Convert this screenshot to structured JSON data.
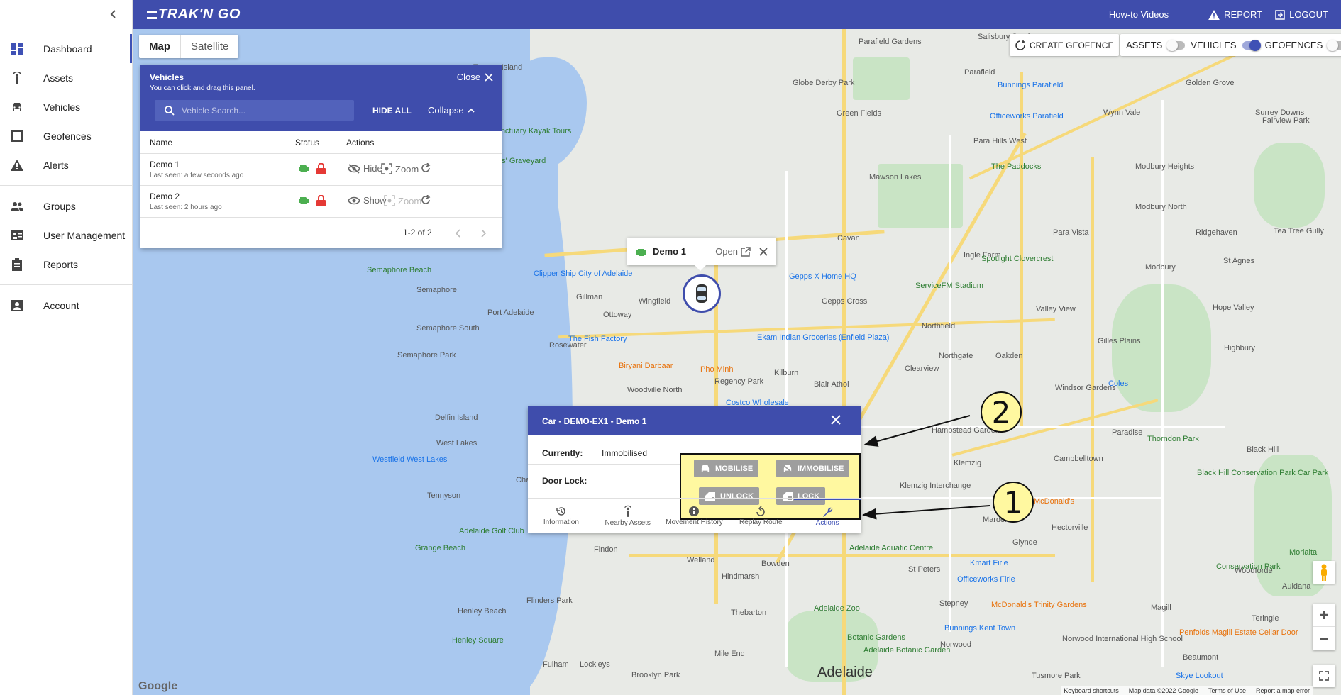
{
  "app": {
    "logo": "TRAK'N GO"
  },
  "sidebar": {
    "items": [
      {
        "label": "Dashboard",
        "icon": "dashboard-icon",
        "active": true
      },
      {
        "label": "Assets",
        "icon": "tracker-icon"
      },
      {
        "label": "Vehicles",
        "icon": "car-icon"
      },
      {
        "label": "Geofences",
        "icon": "square-icon"
      },
      {
        "label": "Alerts",
        "icon": "warning-icon"
      },
      {
        "label": "Groups",
        "icon": "groups-icon"
      },
      {
        "label": "User Management",
        "icon": "user-management-icon"
      },
      {
        "label": "Reports",
        "icon": "clipboard-icon"
      },
      {
        "label": "Account",
        "icon": "account-icon"
      }
    ]
  },
  "topbar": {
    "howto": "How-to Videos",
    "report": "REPORT",
    "logout": "LOGOUT"
  },
  "map": {
    "tab_map": "Map",
    "tab_satellite": "Satellite",
    "create_geofence": "CREATE GEOFENCE",
    "toggle_assets": "ASSETS",
    "toggle_vehicles": "VEHICLES",
    "toggle_geofences": "GEOFENCES",
    "city_label": "Adelaide",
    "google": "Google",
    "attr_shortcuts": "Keyboard shortcuts",
    "attr_data": "Map data ©2022 Google",
    "attr_terms": "Terms of Use",
    "attr_report": "Report a map error"
  },
  "vehicles_panel": {
    "title": "Vehicles",
    "subtitle": "You can click and drag this panel.",
    "close": "Close",
    "search_placeholder": "Vehicle Search...",
    "hide_all": "HIDE ALL",
    "collapse": "Collapse",
    "col_name": "Name",
    "col_status": "Status",
    "col_actions": "Actions",
    "rows": [
      {
        "name": "Demo 1",
        "last_seen": "Last seen: a few seconds ago",
        "vis_action": "Hide",
        "zoom": "Zoom"
      },
      {
        "name": "Demo 2",
        "last_seen": "Last seen: 2 hours ago",
        "vis_action": "Show",
        "zoom": "Zoom"
      }
    ],
    "pagination": "1-2 of 2"
  },
  "popup": {
    "name": "Demo 1",
    "open": "Open"
  },
  "car_panel": {
    "title": "Car - DEMO-EX1 - Demo 1",
    "currently_label": "Currently:",
    "currently_value": "Immobilised",
    "door_lock_label": "Door Lock:",
    "btn_mobilise": "MOBILISE",
    "btn_immobilise": "IMMOBILISE",
    "btn_unlock": "UNLOCK",
    "btn_lock": "LOCK",
    "tabs": [
      "Information",
      "Nearby Assets",
      "Movement History",
      "Replay Route",
      "Actions"
    ]
  },
  "callouts": {
    "one": "1",
    "two": "2"
  },
  "colors": {
    "primary": "#3f4dac",
    "green": "#4caf50",
    "red": "#e53935",
    "highlight": "#fff8a0"
  },
  "map_labels": [
    "Torrens Island",
    "Dolphin Sanctuary Kayak Tours",
    "Garden Island Ships' Graveyard",
    "Gillman",
    "Wingfield",
    "Ottoway",
    "Port Adelaide",
    "Rosewater",
    "Semaphore",
    "Semaphore South",
    "Semaphore Park",
    "Semaphore Beach",
    "Clipper Ship City of Adelaide",
    "The Fish Factory",
    "Biryani Darbaar",
    "Pho Minh",
    "Woodville North",
    "Regency Park",
    "Kilburn",
    "Blair Athol",
    "Cavan",
    "Ingle Farm",
    "Para Vista",
    "Mawson Lakes",
    "Green Fields",
    "Globe Derby Park",
    "Parafield",
    "Parafield Gardens",
    "Salisbury South",
    "Para Hills West",
    "The Paddocks",
    "Golden Grove",
    "Surrey Downs",
    "Wynn Vale",
    "Fairview Park",
    "Modbury Heights",
    "Modbury North",
    "Ridgehaven",
    "Tea Tree Gully",
    "Modbury",
    "St Agnes",
    "Hope Valley",
    "Highbury",
    "Gilles Plains",
    "Valley View",
    "Northfield",
    "Northgate",
    "Oakden",
    "Clearview",
    "Gepps Cross",
    "Ekam Indian Groceries (Enfield Plaza)",
    "Windsor Gardens",
    "Hampstead Gardens",
    "Klemzig",
    "Campbelltown",
    "Paradise",
    "Marden",
    "Hectorville",
    "Glynde",
    "McDonald's",
    "Klemzig Interchange",
    "Delfin Island",
    "West Lakes",
    "Westfield West Lakes",
    "Tennyson",
    "Grange Beach",
    "Adelaide Golf Club",
    "Findon",
    "Welland",
    "Bowden",
    "Hindmarsh",
    "Adelaide Aquatic Centre",
    "St Peters",
    "Norwood",
    "Stepney",
    "Henley Beach",
    "Henley Square",
    "Flinders Park",
    "Thebarton",
    "Adelaide Zoo",
    "Botanic Gardens",
    "Fulham",
    "Lockleys",
    "Brooklyn Park",
    "Mile End",
    "Adelaide",
    "Magill",
    "Teringie",
    "Woodforde",
    "Morialta",
    "Skye Lookout",
    "Tusmore Park",
    "Kmart Firle",
    "Officeworks Firle",
    "Costco Wholesale",
    "ServiceFM Stadium",
    "Spotlight Clovercrest",
    "Gepps X Home HQ",
    "Coles",
    "Black Hill",
    "Black Hill Conservation Park Car Park",
    "Thorndon Park",
    "Conservation Park",
    "Bunnings Parafield",
    "Officeworks Parafield",
    "Bunnings Kent Town",
    "Norwood International High School",
    "Penfolds Magill Estate Cellar Door",
    "McDonald's Trinity Gardens",
    "Auldana",
    "Beaumont",
    "Adelaide Botanic Garden",
    "Cheltenham"
  ]
}
